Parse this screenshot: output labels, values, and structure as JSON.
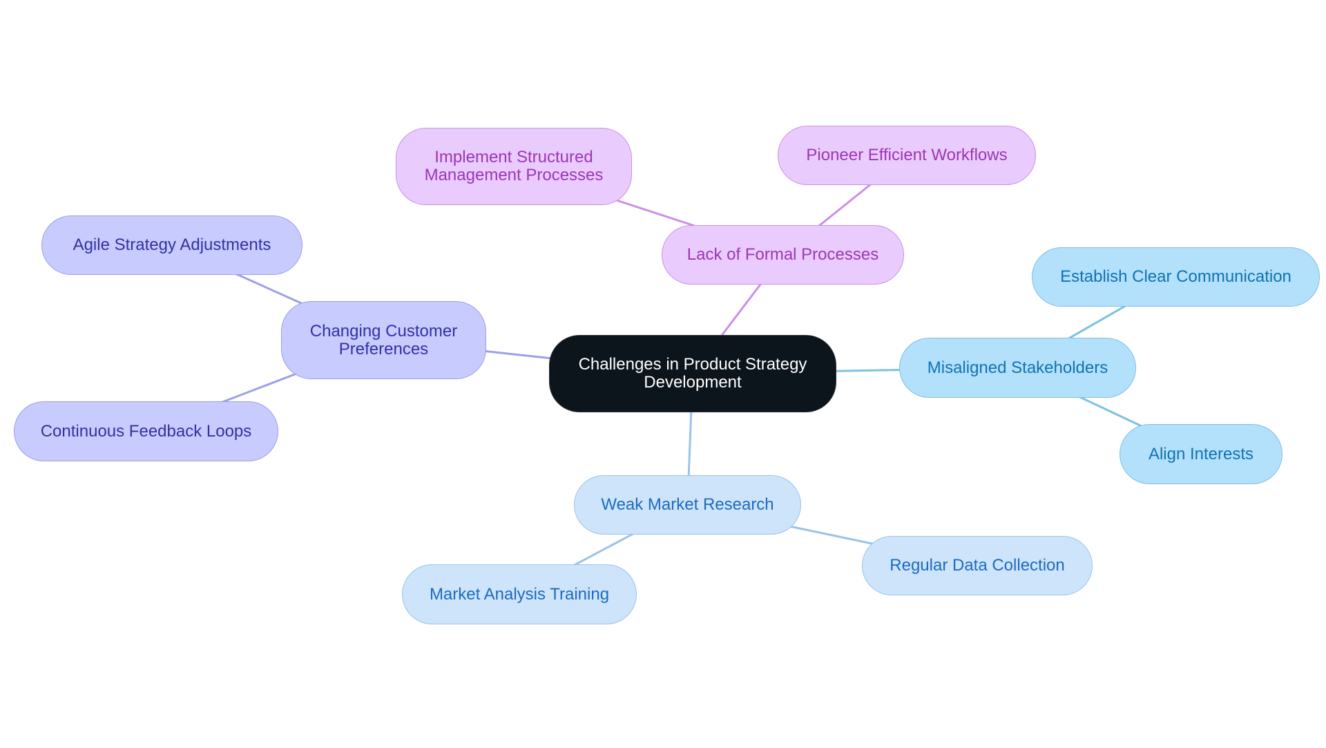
{
  "diagram": {
    "type": "mindmap",
    "root": {
      "id": "root",
      "label": "Challenges in Product Strategy\nDevelopment",
      "color": "#0c141c"
    },
    "branches": [
      {
        "id": "lack",
        "label": "Lack of Formal Processes",
        "theme": "purple",
        "edge_color": "#c98fe9",
        "children": [
          {
            "id": "implement",
            "label": "Implement Structured\nManagement Processes"
          },
          {
            "id": "pioneer",
            "label": "Pioneer Efficient Workflows"
          }
        ]
      },
      {
        "id": "changing",
        "label": "Changing Customer\nPreferences",
        "theme": "indigo",
        "edge_color": "#9c9fe8",
        "children": [
          {
            "id": "agile",
            "label": "Agile Strategy Adjustments"
          },
          {
            "id": "continuous",
            "label": "Continuous Feedback Loops"
          }
        ]
      },
      {
        "id": "misaligned",
        "label": "Misaligned Stakeholders",
        "theme": "sky",
        "edge_color": "#7cc0e6",
        "children": [
          {
            "id": "establish",
            "label": "Establish Clear Communication"
          },
          {
            "id": "align",
            "label": "Align Interests"
          }
        ]
      },
      {
        "id": "weak",
        "label": "Weak Market Research",
        "theme": "blue",
        "edge_color": "#9ac3e9",
        "children": [
          {
            "id": "market",
            "label": "Market Analysis Training"
          },
          {
            "id": "regular",
            "label": "Regular Data Collection"
          }
        ]
      }
    ]
  }
}
